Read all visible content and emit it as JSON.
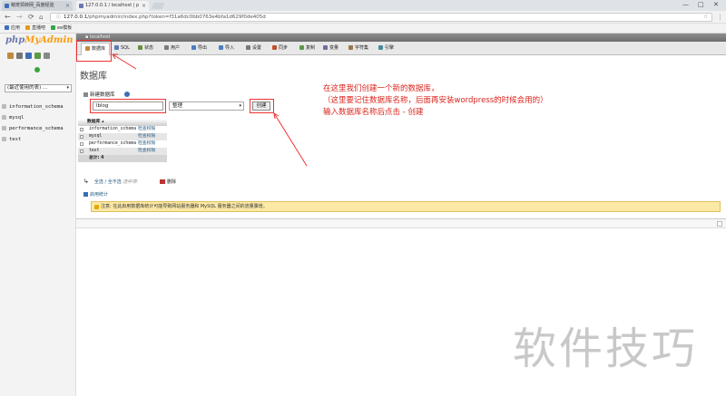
{
  "browser": {
    "tabs": [
      {
        "label": "萌宠领转网_百度经验"
      },
      {
        "label": "127.0.0.1 / localhost | p"
      }
    ],
    "url_host": "127.0.0.1",
    "url_path": "/phpmyadmin/index.php?token=f31a6dc0bb0763e4bfa1d629f0de405d",
    "bookmarks": [
      {
        "label": "应用",
        "color": "#3d6fb8"
      },
      {
        "label": "直播吧",
        "color": "#e09b19"
      },
      {
        "label": "ee模板",
        "color": "#2ea84a"
      }
    ],
    "window_buttons": [
      "—",
      "□",
      "✕"
    ]
  },
  "sidebar": {
    "logo_php": "php",
    "logo_myadmin": "MyAdmin",
    "recent_label": "(最近使用的表) ...",
    "databases": [
      "information_schema",
      "mysql",
      "performance_schema",
      "test"
    ]
  },
  "header": {
    "server_label": "localhost"
  },
  "menu": [
    {
      "label": "数据库",
      "icon": "database-icon",
      "color": "#c08a3e"
    },
    {
      "label": "SQL",
      "icon": "sql-icon",
      "color": "#5c7ab0"
    },
    {
      "label": "状态",
      "icon": "status-icon",
      "color": "#6a8f3a"
    },
    {
      "label": "用户",
      "icon": "users-icon",
      "color": "#7a7a7a"
    },
    {
      "label": "导出",
      "icon": "export-icon",
      "color": "#4a7fc0"
    },
    {
      "label": "导入",
      "icon": "import-icon",
      "color": "#4a7fc0"
    },
    {
      "label": "设置",
      "icon": "settings-icon",
      "color": "#777777"
    },
    {
      "label": "同步",
      "icon": "sync-icon",
      "color": "#c05030"
    },
    {
      "label": "复制",
      "icon": "replication-icon",
      "color": "#5a9a4a"
    },
    {
      "label": "变量",
      "icon": "variables-icon",
      "color": "#7a6a9a"
    },
    {
      "label": "字符集",
      "icon": "charset-icon",
      "color": "#9a7a4a"
    },
    {
      "label": "引擎",
      "icon": "engines-icon",
      "color": "#4a8a9a"
    }
  ],
  "main": {
    "page_title": "数据库",
    "create_label": "新建数据库",
    "db_name_value": "lblog",
    "collation_value": "整理",
    "create_button": "创建",
    "table_header": "数据库",
    "rows": [
      {
        "name": "information_schema",
        "action": "检查权限"
      },
      {
        "name": "mysql",
        "action": "检查权限"
      },
      {
        "name": "performance_schema",
        "action": "检查权限"
      },
      {
        "name": "test",
        "action": "检查权限"
      }
    ],
    "total_label": "总计: 4",
    "select_all": "全选 / 全不选",
    "selected_label": "选中项:",
    "delete_label": "删除",
    "enable_stats": "启用统计",
    "notice": "注意: 在此启用数据库统计可能导致网站服务器和 MySQL 服务器之间的流量骤增。"
  },
  "annotation": {
    "lines": [
      "在这里我们创建一个新的数据库，",
      "（这里要记住数据库名称，后面再安装wordpress的时候会用的）",
      "输入数据库名称后点击 - 创建"
    ]
  },
  "watermark": "软件技巧"
}
